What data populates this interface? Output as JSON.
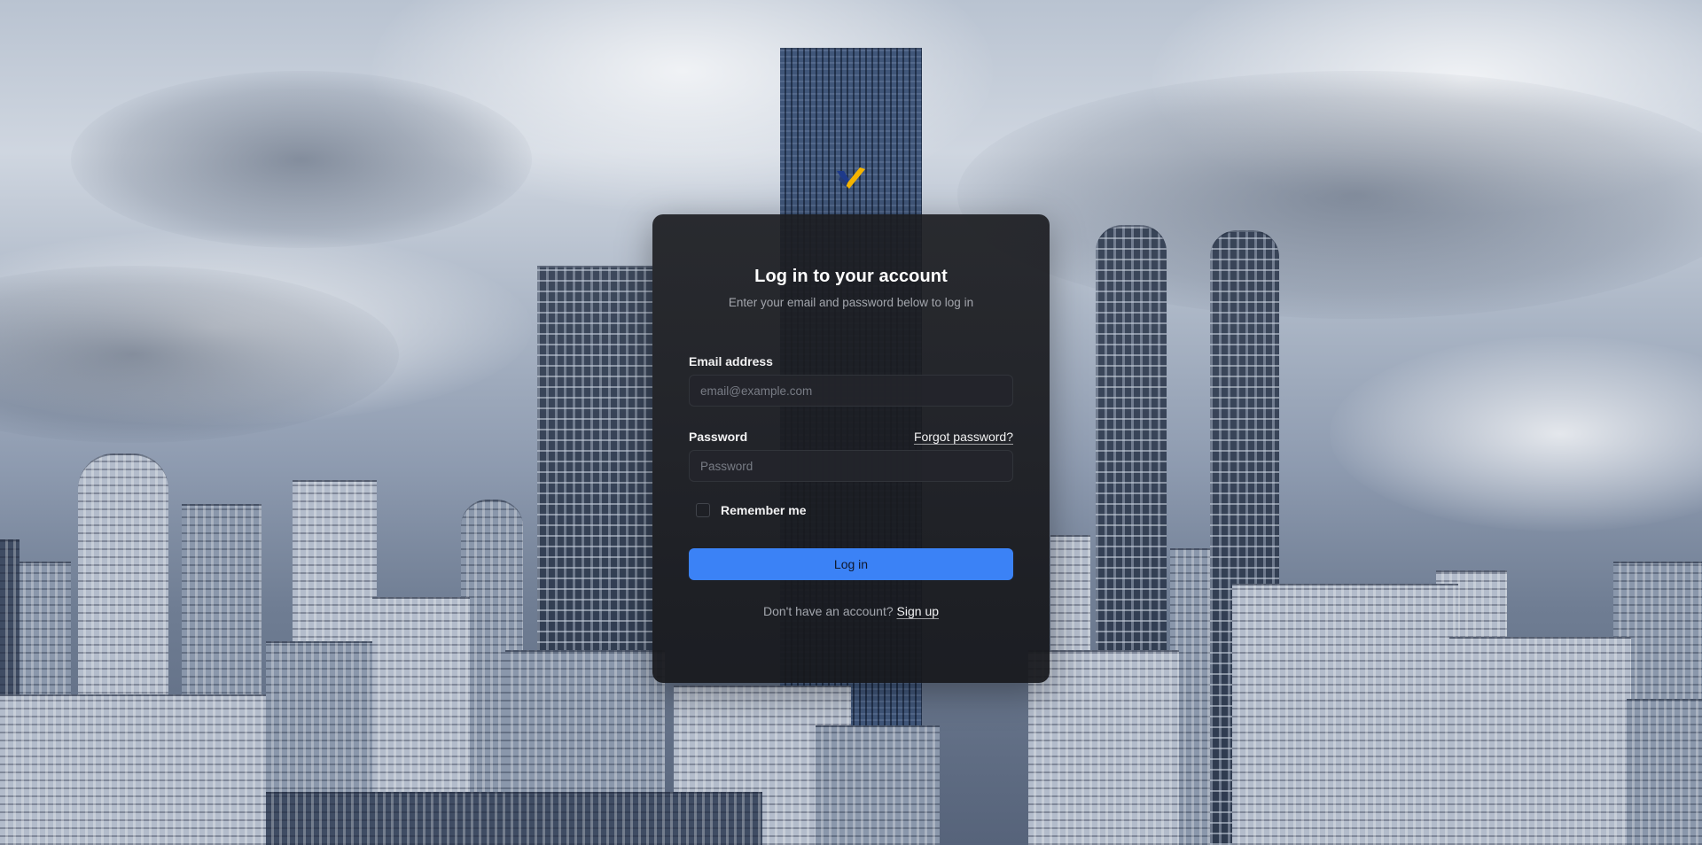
{
  "login": {
    "title": "Log in to your account",
    "subtitle": "Enter your email and password below to log in",
    "email_label": "Email address",
    "email_placeholder": "email@example.com",
    "email_value": "",
    "password_label": "Password",
    "forgot_password": "Forgot password?",
    "password_placeholder": "Password",
    "password_value": "",
    "remember_label": "Remember me",
    "remember_checked": false,
    "submit_label": "Log in",
    "signup_prompt": "Don't have an account?",
    "signup_link": "Sign up"
  },
  "logo": {
    "icon": "checkmark-logo-icon"
  },
  "colors": {
    "primary_button": "#3b82f6",
    "card_background": "#1c1d21",
    "logo_primary": "#f5b400",
    "logo_secondary": "#1e3a8a"
  }
}
